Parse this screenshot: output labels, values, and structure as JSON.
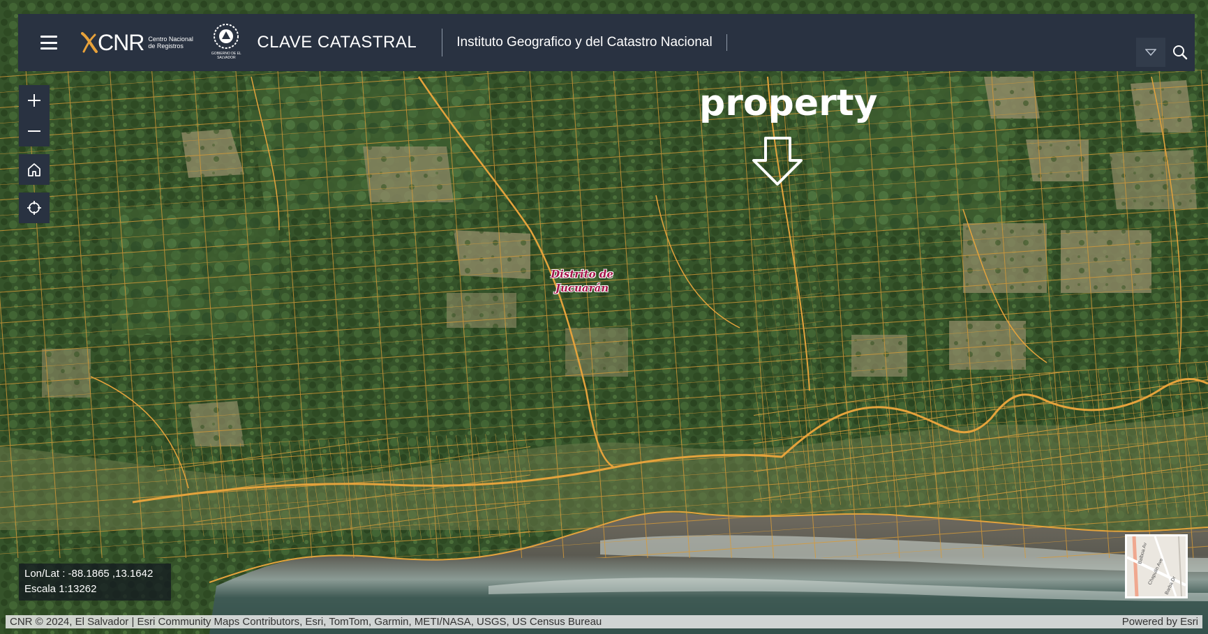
{
  "header": {
    "logo_text": "CNR",
    "logo_sub": "Centro Nacional de Registros",
    "seal_sub": "GOBIERNO DE EL SALVADOR",
    "app_title": "CLAVE CATASTRAL",
    "institute": "Instituto Geografico y del Catastro Nacional"
  },
  "map": {
    "annotation": "property",
    "place_label_line1": "Distrito de",
    "place_label_line2": "Jucuarán",
    "coords": "Lon/Lat : -88.1865 ,13.1642",
    "scale": "Escala 1:13262",
    "attribution": "CNR © 2024, El Salvador | Esri Community Maps Contributors, Esri, TomTom, Garmin, METI/NASA, USGS, US Census Bureau",
    "powered_by": "Powered by Esri",
    "overview_labels": [
      "Balboa Av",
      "Chapulin Ave",
      "Barba Dr"
    ]
  },
  "colors": {
    "header_bg": "#293241",
    "parcel_line": "#e7a43a",
    "forest": "#2f4a22",
    "ocean": "#3f5a52",
    "beach": "#6d6257"
  }
}
